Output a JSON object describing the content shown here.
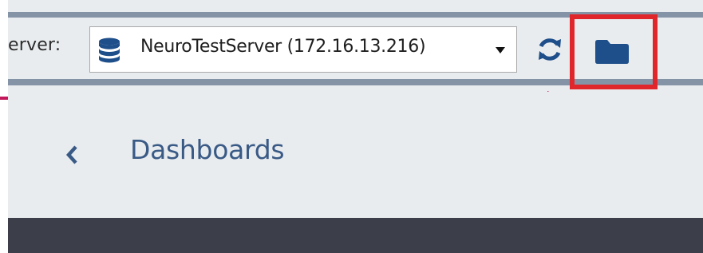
{
  "toolbar": {
    "server_label": "erver:",
    "server_value": "NeuroTestServer (172.16.13.216)",
    "server_icon": "database-icon",
    "dropdown_icon": "caret-down-icon",
    "refresh_icon": "refresh-icon",
    "folder_icon": "folder-icon"
  },
  "breadcrumb": {
    "back_icon": "chevron-left-icon",
    "title": "Dashboards"
  },
  "annotation": {
    "highlight_color": "#e0262b",
    "arrow_color": "#c2185b"
  },
  "colors": {
    "toolbar_bg": "#e9ecef",
    "toolbar_line": "#8593a6",
    "accent_blue": "#1f4f8a",
    "title_blue": "#3a5a86",
    "dark_band": "#3c3f49"
  }
}
